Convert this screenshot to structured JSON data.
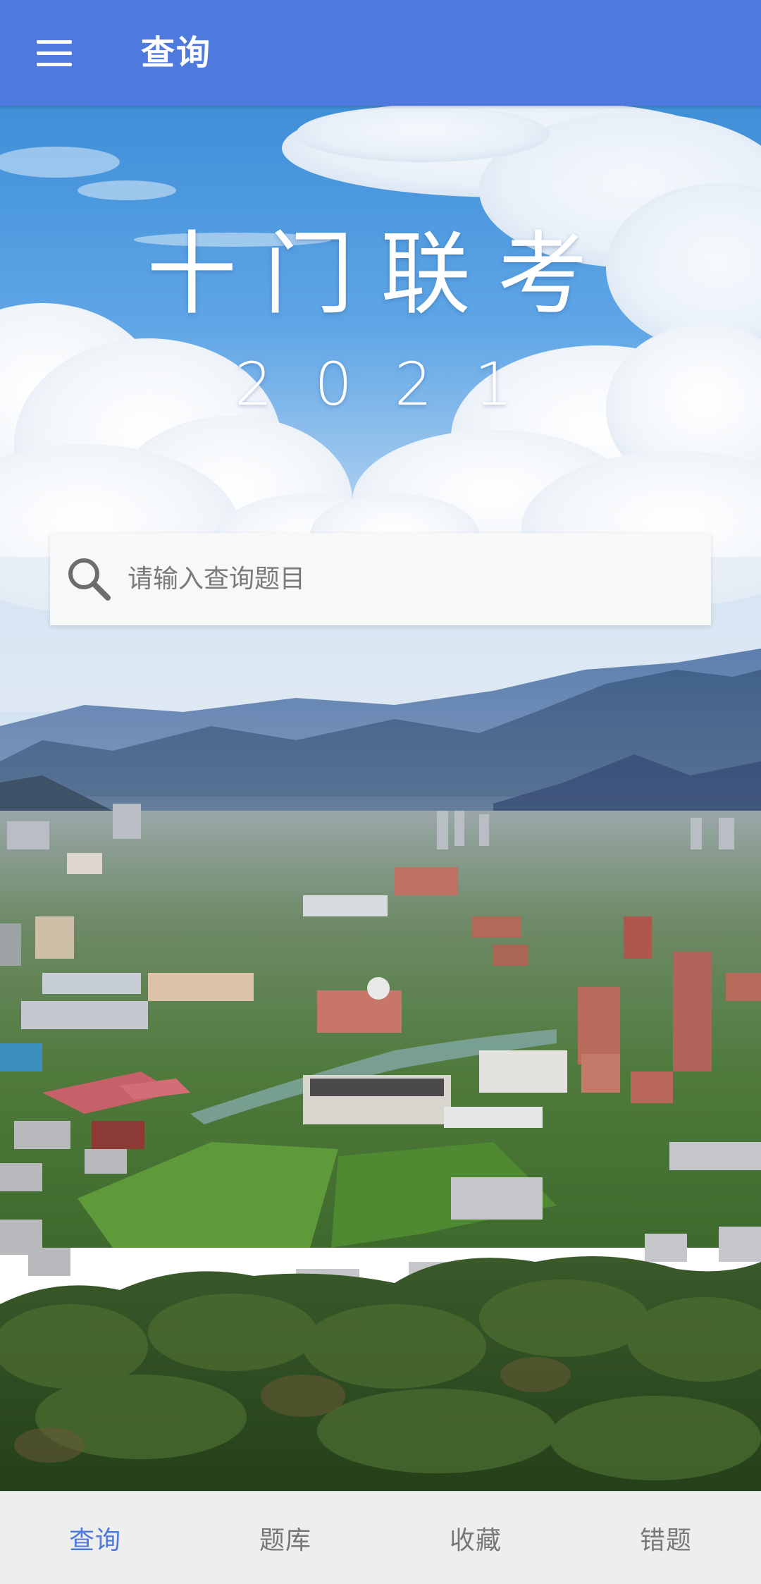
{
  "app_bar": {
    "title": "查询",
    "menu_icon": "hamburger-menu-icon",
    "background": "#4e79dd"
  },
  "hero": {
    "title": "十门联考",
    "year": "2021",
    "scene": "campus-landscape-with-mountains-and-clouds"
  },
  "search": {
    "placeholder": "请输入查询题目",
    "value": "",
    "icon": "search-icon"
  },
  "bottom_nav": {
    "active_color": "#4e79dd",
    "items": [
      {
        "label": "查询",
        "active": true
      },
      {
        "label": "题库",
        "active": false
      },
      {
        "label": "收藏",
        "active": false
      },
      {
        "label": "错题",
        "active": false
      }
    ]
  }
}
